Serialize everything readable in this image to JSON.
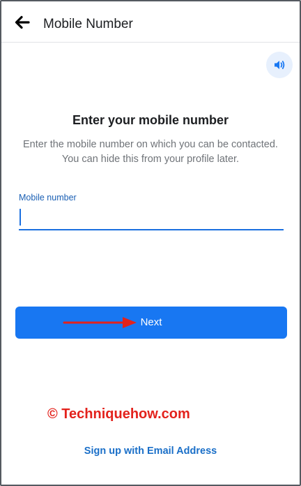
{
  "header": {
    "title": "Mobile Number",
    "back_icon": "arrow-left-icon"
  },
  "audio_button": {
    "icon": "speaker-icon",
    "accent": "#1877f2",
    "background": "#e7f0fd"
  },
  "main": {
    "heading": "Enter your mobile number",
    "description": "Enter the mobile number on which you can be contacted. You can hide this from your profile later."
  },
  "mobile_field": {
    "label": "Mobile number",
    "value": ""
  },
  "next_button": {
    "label": "Next",
    "color": "#1877f2"
  },
  "annotation": {
    "color": "#e3221c"
  },
  "watermark": {
    "text": "© Techniquehow.com",
    "color": "#e3221c"
  },
  "footer": {
    "email_signup_label": "Sign up with Email Address",
    "link_color": "#1a6fc8"
  }
}
